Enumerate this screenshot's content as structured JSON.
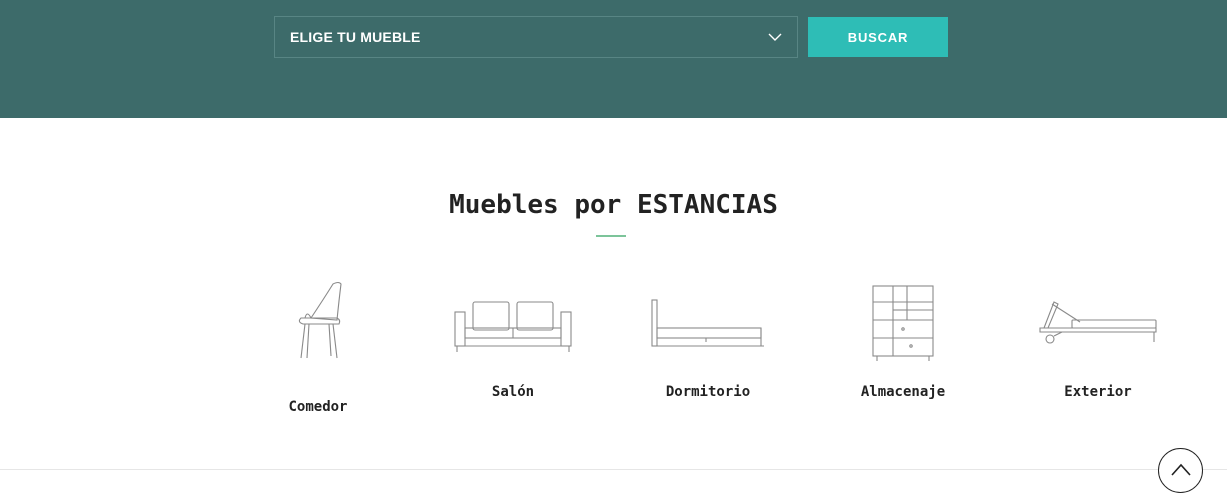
{
  "search": {
    "select_label": "ELIGE TU MUEBLE",
    "button_label": "BUSCAR"
  },
  "section": {
    "title": "Muebles por ESTANCIAS"
  },
  "rooms": [
    {
      "label": "Comedor",
      "icon": "chair-icon"
    },
    {
      "label": "Salón",
      "icon": "sofa-icon"
    },
    {
      "label": "Dormitorio",
      "icon": "bed-icon"
    },
    {
      "label": "Almacenaje",
      "icon": "shelf-icon"
    },
    {
      "label": "Exterior",
      "icon": "sunbed-icon"
    }
  ],
  "colors": {
    "hero_bg": "#3d6b6a",
    "button_bg": "#2ebdb6",
    "accent_rule": "#7cc49a"
  },
  "scroll_top": {
    "icon": "chevron-up-icon"
  }
}
